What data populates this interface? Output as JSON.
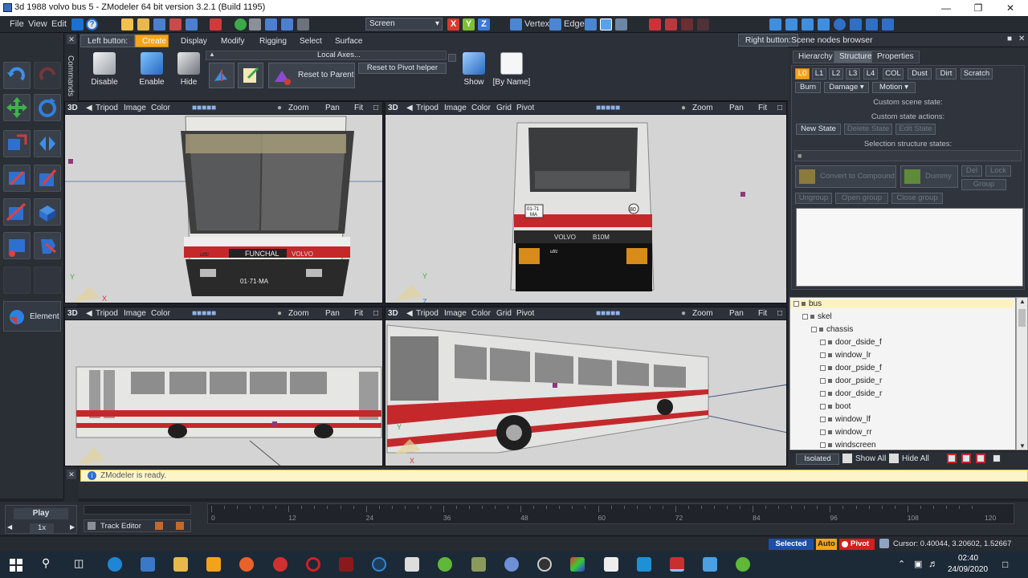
{
  "window": {
    "title": "3d 1988 volvo bus 5 - ZModeler 64 bit version 3.2.1 (Build 1195)"
  },
  "menu": {
    "items": [
      "File",
      "View",
      "Edit"
    ]
  },
  "toolbar": {
    "screen_select": "Screen",
    "vertex_label": "Vertex",
    "edge_label": "Edge"
  },
  "ribbon": {
    "left_button_label": "Left button:",
    "tabs": [
      "Create",
      "Display",
      "Modify",
      "Rigging",
      "Select",
      "Surface"
    ],
    "local_axes": "Local Axes...",
    "buttons": {
      "disable": "Disable",
      "enable": "Enable",
      "hide": "Hide",
      "reset_to_parent": "Reset to Parent",
      "reset_to_pivot": "Reset to Pivot helper",
      "show": "Show",
      "by_name": "[By Name]"
    }
  },
  "left_panel": {
    "commands_label": "Commands",
    "element_label": "Element"
  },
  "viewports": [
    {
      "mode": "3D",
      "items": [
        "Tripod",
        "Image",
        "Color"
      ],
      "zoom": "Zoom",
      "pan": "Pan",
      "fit": "Fit"
    },
    {
      "mode": "3D",
      "items": [
        "Tripod",
        "Image",
        "Color",
        "Grid",
        "Pivot"
      ],
      "zoom": "Zoom",
      "pan": "Pan",
      "fit": "Fit"
    },
    {
      "mode": "3D",
      "items": [
        "Tripod",
        "Image",
        "Color"
      ],
      "zoom": "Zoom",
      "pan": "Pan",
      "fit": "Fit"
    },
    {
      "mode": "3D",
      "items": [
        "Tripod",
        "Image",
        "Color",
        "Grid",
        "Pivot"
      ],
      "zoom": "Zoom",
      "pan": "Pan",
      "fit": "Fit"
    }
  ],
  "bus": {
    "front_sign": "FUNCHAL",
    "front_plate": "01·71·MA",
    "rear_plate_top": "01-71",
    "rear_plate_bottom": "MA",
    "rear_number": "80",
    "rear_brand": "VOLVO",
    "rear_model": "B10M",
    "badge": "VOLVO",
    "logo": "uttc"
  },
  "right_panel": {
    "right_button_label": "Right button:",
    "title": "Scene nodes browser",
    "tabs": [
      "Hierarchy",
      "Structure",
      "Properties"
    ],
    "state_buttons": [
      "L0",
      "L1",
      "L2",
      "L3",
      "L4",
      "COL",
      "Dust",
      "Dirt",
      "Scratch"
    ],
    "state_buttons_2": [
      "Burn",
      "Damage",
      "Motion"
    ],
    "custom_scene_state": "Custom scene state:",
    "custom_state_actions": "Custom state actions:",
    "action_buttons": [
      "New State",
      "Delete State",
      "Edit State"
    ],
    "selection_structure_states": "Selection structure states:",
    "convert_to_compound": "Convert to Compound",
    "dummy": "Dummy",
    "del": "Del",
    "lock": "Lock",
    "group": "Group",
    "ungroup": "Ungroup",
    "open_group": "Open group",
    "close_group": "Close group"
  },
  "tree": {
    "nodes": [
      {
        "label": "bus",
        "level": 0
      },
      {
        "label": "skel",
        "level": 1
      },
      {
        "label": "chassis",
        "level": 2
      },
      {
        "label": "door_dside_f",
        "level": 3
      },
      {
        "label": "window_lr",
        "level": 3
      },
      {
        "label": "door_pside_f",
        "level": 3
      },
      {
        "label": "door_pside_r",
        "level": 3
      },
      {
        "label": "door_dside_r",
        "level": 3
      },
      {
        "label": "boot",
        "level": 3
      },
      {
        "label": "window_lf",
        "level": 3
      },
      {
        "label": "window_rr",
        "level": 3
      },
      {
        "label": "windscreen",
        "level": 3
      }
    ]
  },
  "tree_toolbar": {
    "isolated": "Isolated",
    "show_all": "Show All",
    "hide_all": "Hide All"
  },
  "status": {
    "ready": "ZModeler is ready."
  },
  "timeline": {
    "play": "Play",
    "speed": "1x",
    "track_editor": "Track Editor",
    "ticks": [
      "0",
      "12",
      "24",
      "36",
      "48",
      "60",
      "72",
      "84",
      "96",
      "108",
      "120"
    ]
  },
  "bottom": {
    "selected": "Selected",
    "auto": "Auto",
    "pivot": "Pivot",
    "cursor": "Cursor: 0.40044, 3.20602, 1.52667"
  },
  "taskbar": {
    "time": "02:40",
    "date": "24/09/2020"
  },
  "colors": {
    "accent": "#f5a51b",
    "bus_red": "#c4282b",
    "panel": "#2a2e35"
  }
}
